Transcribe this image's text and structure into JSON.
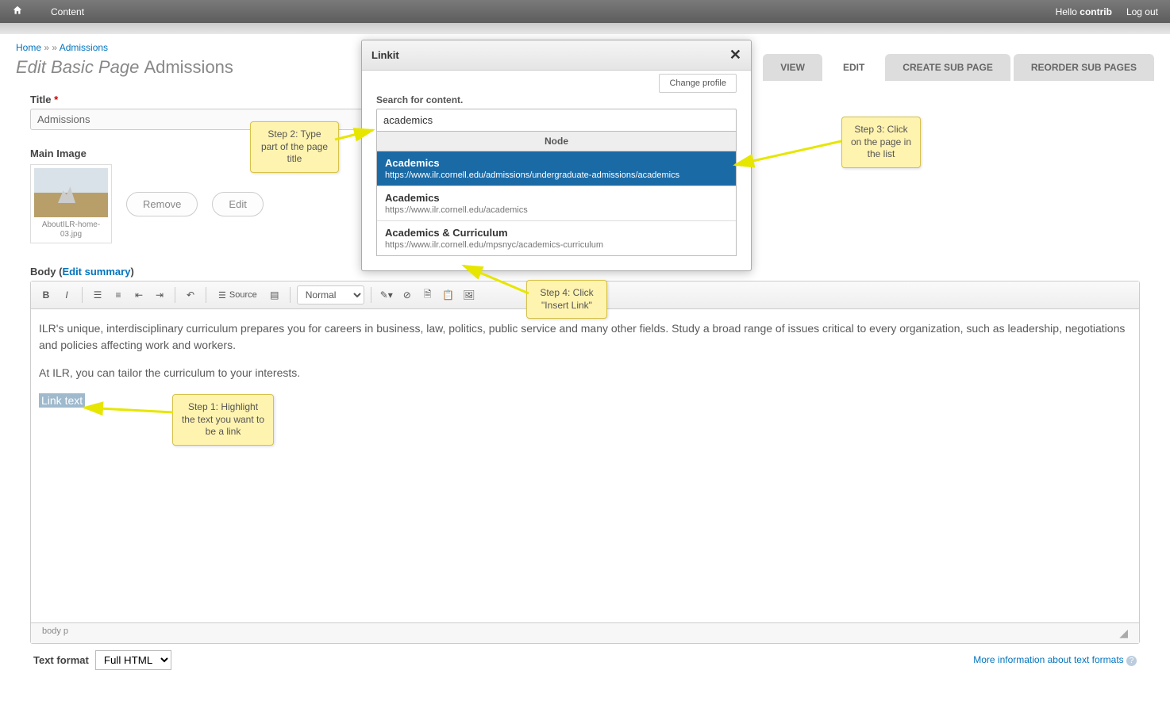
{
  "topbar": {
    "content_link": "Content",
    "hello_prefix": "Hello ",
    "username": "contrib",
    "logout": "Log out"
  },
  "breadcrumb": {
    "home": "Home",
    "sep1": " » » ",
    "admissions": "Admissions"
  },
  "page_title": {
    "prefix": "Edit Basic Page ",
    "suffix": "Admissions"
  },
  "tabs": {
    "view": "VIEW",
    "edit": "EDIT",
    "create_sub": "CREATE SUB PAGE",
    "reorder_sub": "REORDER SUB PAGES"
  },
  "title_field": {
    "label": "Title ",
    "value": "Admissions"
  },
  "main_image": {
    "label": "Main Image",
    "filename": "AboutILR-home-03.jpg",
    "remove": "Remove",
    "edit": "Edit"
  },
  "body_section": {
    "label_pre": "Body (",
    "edit_summary": "Edit summary",
    "label_post": ")"
  },
  "toolbar": {
    "source": "Source",
    "format": "Normal"
  },
  "editor_text": {
    "p1": "ILR's unique, interdisciplinary curriculum prepares you for careers in business, law, politics, public service and many other fields. Study a broad range of issues critical to every organization, such as leadership, negotiations and policies affecting work and workers.",
    "p2": "At ILR, you can tailor the curriculum to your interests.",
    "link_text": "Link text"
  },
  "editor_footer": {
    "path": "body   p"
  },
  "text_format": {
    "label": "Text format",
    "value": "Full HTML",
    "more_info": "More information about text formats"
  },
  "dialog": {
    "title": "Linkit",
    "change_profile": "Change profile",
    "search_label": "Search for content.",
    "search_value": "academics",
    "dd_header": "Node",
    "items": [
      {
        "title": "Academics",
        "url": "https://www.ilr.cornell.edu/admissions/undergraduate-admissions/academics",
        "selected": true
      },
      {
        "title": "Academics",
        "url": "https://www.ilr.cornell.edu/academics",
        "selected": false
      },
      {
        "title": "Academics & Curriculum",
        "url": "https://www.ilr.cornell.edu/mpsnyc/academics-curriculum",
        "selected": false
      }
    ]
  },
  "callouts": {
    "step1": "Step 1: Highlight the text you want to be a link",
    "step2": "Step 2: Type part of the page title",
    "step3": "Step 3: Click on the page in the list",
    "step4": "Step 4: Click \"Insert Link\""
  }
}
